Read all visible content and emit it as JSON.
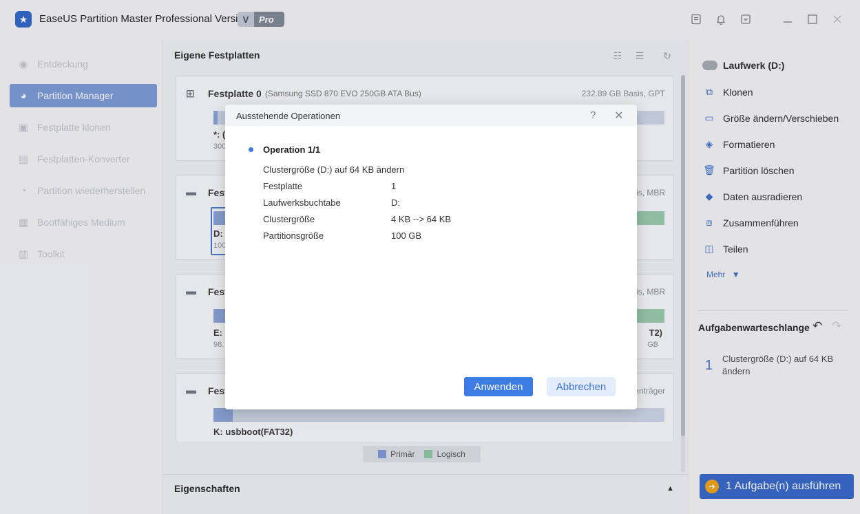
{
  "app": {
    "title": "EaseUS Partition Master Professional Version",
    "badge_v": "V",
    "badge_pro": "Pro"
  },
  "titlebar_icons": [
    "notes-icon",
    "bell-icon",
    "dropdown-box-icon",
    "minimize-icon",
    "maximize-icon",
    "close-icon"
  ],
  "sidebar": {
    "items": [
      {
        "label": "Entdeckung",
        "icon": "compass-icon",
        "active": false
      },
      {
        "label": "Partition Manager",
        "icon": "pie-chart-icon",
        "active": true
      },
      {
        "label": "Festplatte klonen",
        "icon": "clone-disk-icon",
        "active": false
      },
      {
        "label": "Festplatten-Konverter",
        "icon": "converter-icon",
        "active": false
      },
      {
        "label": "Partition wiederherstellen",
        "icon": "recover-icon",
        "active": false
      },
      {
        "label": "Bootfähiges Medium",
        "icon": "boot-media-icon",
        "active": false
      },
      {
        "label": "Toolkit",
        "icon": "toolkit-icon",
        "active": false
      }
    ]
  },
  "main": {
    "title": "Eigene Festplatten",
    "disks": [
      {
        "name": "Festplatte 0",
        "sub": "(Samsung SSD 870 EVO 250GB ATA Bus)",
        "right": "232.89 GB Basis, GPT",
        "part_label": "*: (",
        "part_small": "300"
      },
      {
        "name": "Fest",
        "right": "sis, MBR",
        "part_label": "D:",
        "part_small": "100"
      },
      {
        "name": "Fest",
        "right": "sis, MBR",
        "part_label": "E: (",
        "part_small": "98.",
        "right_label": "T2)",
        "right_small": "GB"
      },
      {
        "name": "Fest",
        "right": "enträger",
        "part_label": "K: usbboot(FAT32)"
      }
    ],
    "legend": {
      "primary": "Primär",
      "logical": "Logisch"
    },
    "properties": "Eigenschaften"
  },
  "right_panel": {
    "drive": "Laufwerk (D:)",
    "actions": [
      {
        "label": "Klonen",
        "icon": "clone-icon"
      },
      {
        "label": "Größe ändern/Verschieben",
        "icon": "resize-icon"
      },
      {
        "label": "Formatieren",
        "icon": "format-icon"
      },
      {
        "label": "Partition löschen",
        "icon": "trash-icon"
      },
      {
        "label": "Daten ausradieren",
        "icon": "eraser-icon"
      },
      {
        "label": "Zusammenführen",
        "icon": "merge-icon"
      },
      {
        "label": "Teilen",
        "icon": "split-icon"
      }
    ],
    "more": "Mehr",
    "queue_title": "Aufgabenwarteschlange",
    "queue_items": [
      {
        "num": "1",
        "text": "Clustergröße (D:) auf 64 KB ändern"
      }
    ],
    "run_button": "1 Aufgabe(n) ausführen"
  },
  "dialog": {
    "title": "Ausstehende Operationen",
    "operation_title": "Operation 1/1",
    "operation_desc": "Clustergröße (D:) auf 64 KB ändern",
    "rows": [
      {
        "label": "Festplatte",
        "value": "1"
      },
      {
        "label": "Laufwerksbuchtabe",
        "value": "D:"
      },
      {
        "label": "Clustergröße",
        "value": "4 KB --> 64 KB"
      },
      {
        "label": "Partitionsgröße",
        "value": "100 GB"
      }
    ],
    "apply": "Anwenden",
    "cancel": "Abbrechen"
  },
  "colors": {
    "primary": "#3d7ce2",
    "primary_partition": "#7f9ad6",
    "logical_partition": "#8fc7a6",
    "sidebar_active": "#7b9bd5",
    "run_icon": "#f0a317"
  }
}
